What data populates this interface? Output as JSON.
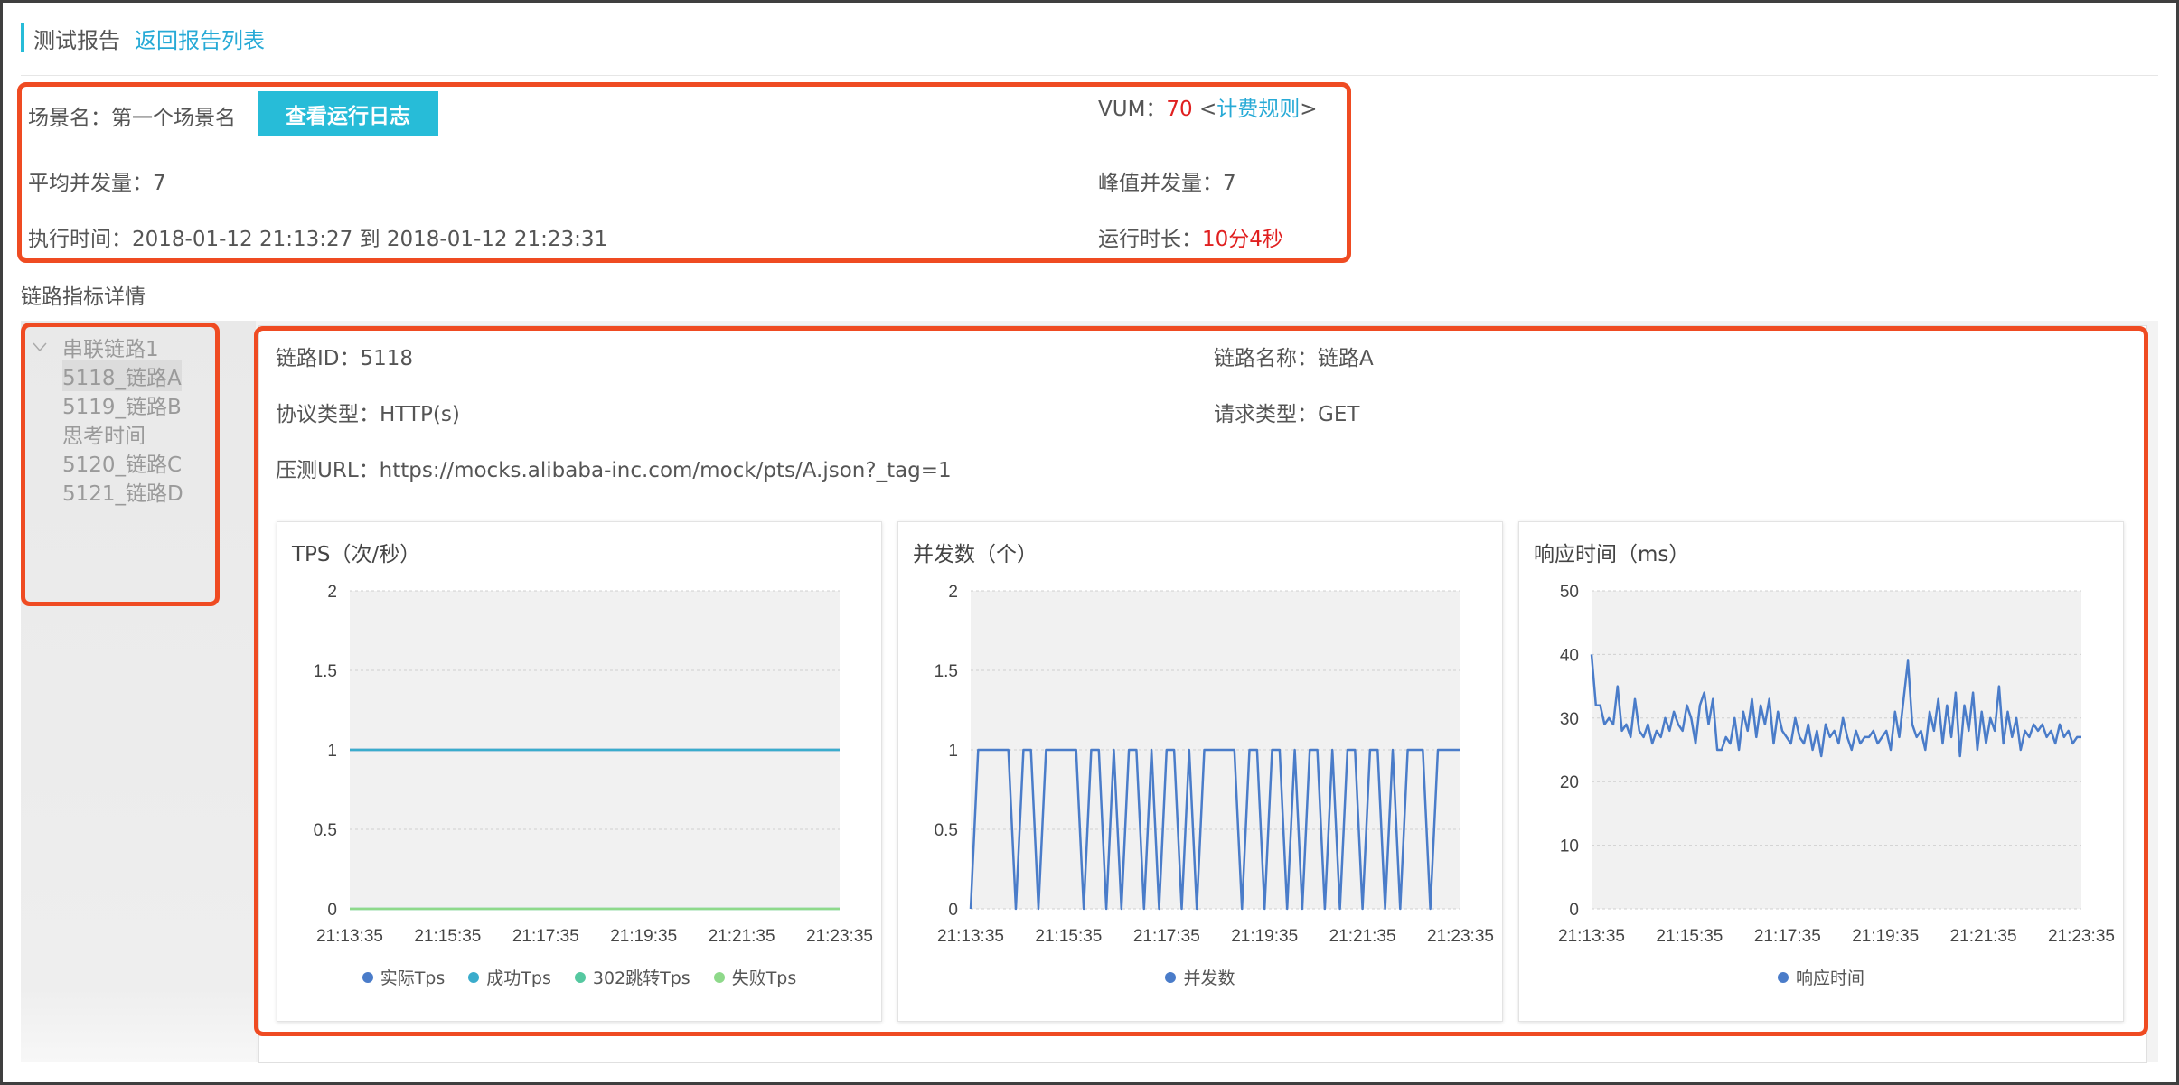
{
  "header": {
    "title": "测试报告",
    "back_link": "返回报告列表"
  },
  "summary": {
    "scene_label": "场景名：第一个场景名",
    "log_button": "查看运行日志",
    "vum_label": "VUM：",
    "vum_value": "70",
    "billing_open": " <",
    "billing_link": "计费规则",
    "billing_close": ">",
    "avg_concurrency": "平均并发量：7",
    "peak_concurrency": "峰值并发量：7",
    "exec_time": "执行时间：2018-01-12 21:13:27 到 2018-01-12 21:23:31",
    "duration_label": "运行时长：",
    "duration_value": "10分4秒"
  },
  "section_title": "链路指标详情",
  "tree": {
    "root": "串联链路1",
    "items": [
      "5118_链路A",
      "5119_链路B",
      "思考时间",
      "5120_链路C",
      "5121_链路D"
    ],
    "selected_index": 0
  },
  "link_detail": {
    "id": "链路ID：5118",
    "name": "链路名称：链路A",
    "protocol": "协议类型：HTTP(s)",
    "method": "请求类型：GET",
    "url": "压测URL：https://mocks.alibaba-inc.com/mock/pts/A.json?_tag=1"
  },
  "colors": {
    "accent": "#27bcd8",
    "link": "#27aad6",
    "highlight_box": "#ef4b22",
    "value_red": "#e02020"
  },
  "chart_data": [
    {
      "type": "line",
      "title": "TPS（次/秒）",
      "x": [
        "21:13:35",
        "21:15:35",
        "21:17:35",
        "21:19:35",
        "21:21:35",
        "21:23:35"
      ],
      "ylim": [
        0,
        2
      ],
      "yticks": [
        "0",
        "0.5",
        "1",
        "1.5",
        "2"
      ],
      "grid": true,
      "legend": "bottom",
      "series": [
        {
          "name": "实际Tps",
          "color": "#4a7cc9",
          "values": [
            1,
            1,
            1,
            1,
            1,
            1
          ]
        },
        {
          "name": "成功Tps",
          "color": "#3aaccc",
          "values": [
            1,
            1,
            1,
            1,
            1,
            1
          ]
        },
        {
          "name": "302跳转Tps",
          "color": "#55c8a0",
          "values": [
            0,
            0,
            0,
            0,
            0,
            0
          ]
        },
        {
          "name": "失败Tps",
          "color": "#8ed98a",
          "values": [
            0,
            0,
            0,
            0,
            0,
            0
          ]
        }
      ]
    },
    {
      "type": "line",
      "title": "并发数（个）",
      "x": [
        "21:13:35",
        "21:15:35",
        "21:17:35",
        "21:19:35",
        "21:21:35",
        "21:23:35"
      ],
      "ylim": [
        0,
        2
      ],
      "yticks": [
        "0",
        "0.5",
        "1",
        "1.5",
        "2"
      ],
      "grid": true,
      "legend": "bottom",
      "series": [
        {
          "name": "并发数",
          "color": "#4a7cc9",
          "values": [
            0,
            1,
            1,
            1,
            1,
            1,
            0,
            1,
            1,
            0,
            1,
            1,
            1,
            1,
            1,
            0,
            1,
            1,
            0,
            1,
            0,
            1,
            1,
            0,
            1,
            0,
            1,
            1,
            0,
            1,
            0,
            1,
            1,
            1,
            1,
            1,
            0,
            1,
            1,
            0,
            1,
            1,
            0,
            1,
            0,
            1,
            1,
            0,
            1,
            0,
            1,
            1,
            0,
            1,
            1,
            0,
            1,
            0,
            1,
            1,
            1,
            0,
            1,
            1,
            1,
            1
          ]
        }
      ]
    },
    {
      "type": "line",
      "title": "响应时间（ms）",
      "x": [
        "21:13:35",
        "21:15:35",
        "21:17:35",
        "21:19:35",
        "21:21:35",
        "21:23:35"
      ],
      "ylim": [
        0,
        50
      ],
      "yticks": [
        "0",
        "10",
        "20",
        "30",
        "40",
        "50"
      ],
      "grid": true,
      "legend": "bottom",
      "series": [
        {
          "name": "响应时间",
          "color": "#4a7cc9",
          "values": [
            40,
            32,
            32,
            29,
            30,
            29,
            35,
            28,
            29,
            27,
            33,
            28,
            27,
            29,
            26,
            28,
            27,
            30,
            28,
            31,
            29,
            28,
            32,
            30,
            26,
            32,
            34,
            29,
            33,
            25,
            25,
            27,
            26,
            30,
            25,
            31,
            28,
            33,
            27,
            32,
            29,
            33,
            26,
            31,
            28,
            27,
            26,
            30,
            27,
            26,
            29,
            25,
            28,
            24,
            29,
            27,
            28,
            26,
            30,
            27,
            25,
            28,
            26,
            27,
            27,
            28,
            26,
            27,
            28,
            25,
            31,
            27,
            33,
            39,
            29,
            27,
            28,
            25,
            31,
            28,
            33,
            26,
            32,
            27,
            34,
            24,
            32,
            28,
            34,
            25,
            31,
            26,
            30,
            28,
            35,
            26,
            31,
            27,
            30,
            25,
            28,
            27,
            29,
            28,
            29,
            27,
            28,
            26,
            29,
            27,
            28,
            26,
            27,
            27
          ]
        }
      ]
    }
  ]
}
